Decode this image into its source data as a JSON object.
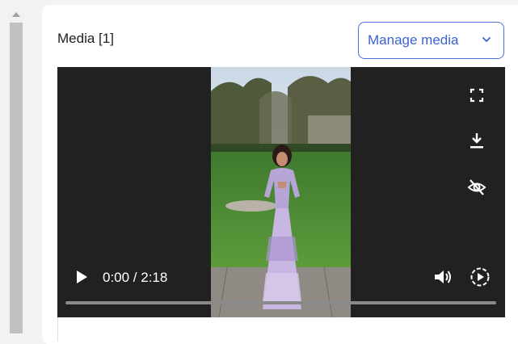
{
  "media": {
    "title": "Media [1]",
    "manage_label": "Manage media"
  },
  "player": {
    "time_display": "0:00 / 2:18",
    "progress": 0,
    "icons": [
      "fullscreen-icon",
      "download-icon",
      "hide-icon",
      "play-icon",
      "volume-icon",
      "playback-speed-icon"
    ]
  },
  "colors": {
    "accent": "#3b63d1",
    "player_bg": "#212121"
  }
}
